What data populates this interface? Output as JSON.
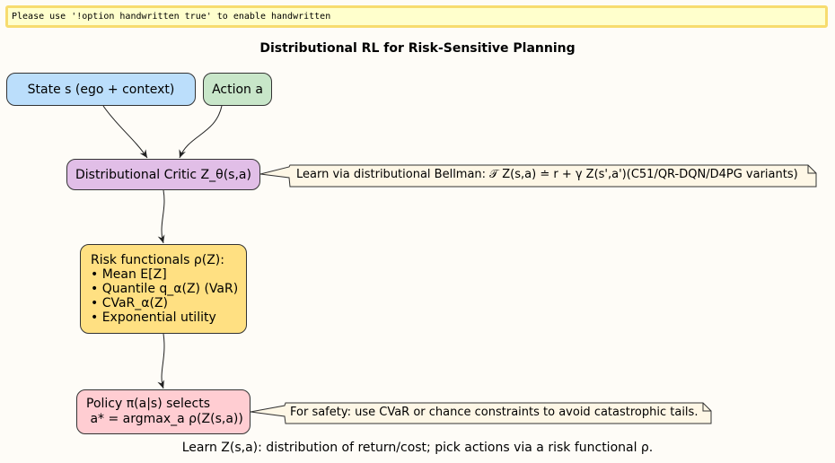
{
  "banner": "Please use '!option handwritten true' to enable handwritten",
  "title": "Distributional RL for Risk-Sensitive Planning",
  "nodes": {
    "state": "State s (ego + context)",
    "action": "Action a",
    "critic": "Distributional Critic Z_θ(s,a)",
    "risk": {
      "heading": "Risk functionals ρ(Z):",
      "items": [
        "• Mean E[Z]",
        "• Quantile q_α(Z) (VaR)",
        "• CVaR_α(Z)",
        "• Exponential utility"
      ]
    },
    "policy": {
      "line1": "Policy π(a|s) selects",
      "line2": " a* = argmax_a ρ(Z(s,a))"
    }
  },
  "notes": {
    "bellman": "Learn via distributional Bellman: 𝒯 Z(s,a) ≐ r + γ Z(s',a')(C51/QR-DQN/D4PG variants)",
    "safety": "For safety: use CVaR or chance constraints to avoid catastrophic tails."
  },
  "caption": "Learn Z(s,a): distribution of return/cost; pick actions via a risk functional ρ.",
  "colors": {
    "background": "#FEFCF7",
    "state": "#BBDEFB",
    "action": "#C8E6C9",
    "critic": "#E1BEE7",
    "risk": "#FFE082",
    "policy": "#FFCDD2",
    "note": "#FEF7E6",
    "banner": "#FFFFCC",
    "banner_border": "#F7DC6F"
  }
}
